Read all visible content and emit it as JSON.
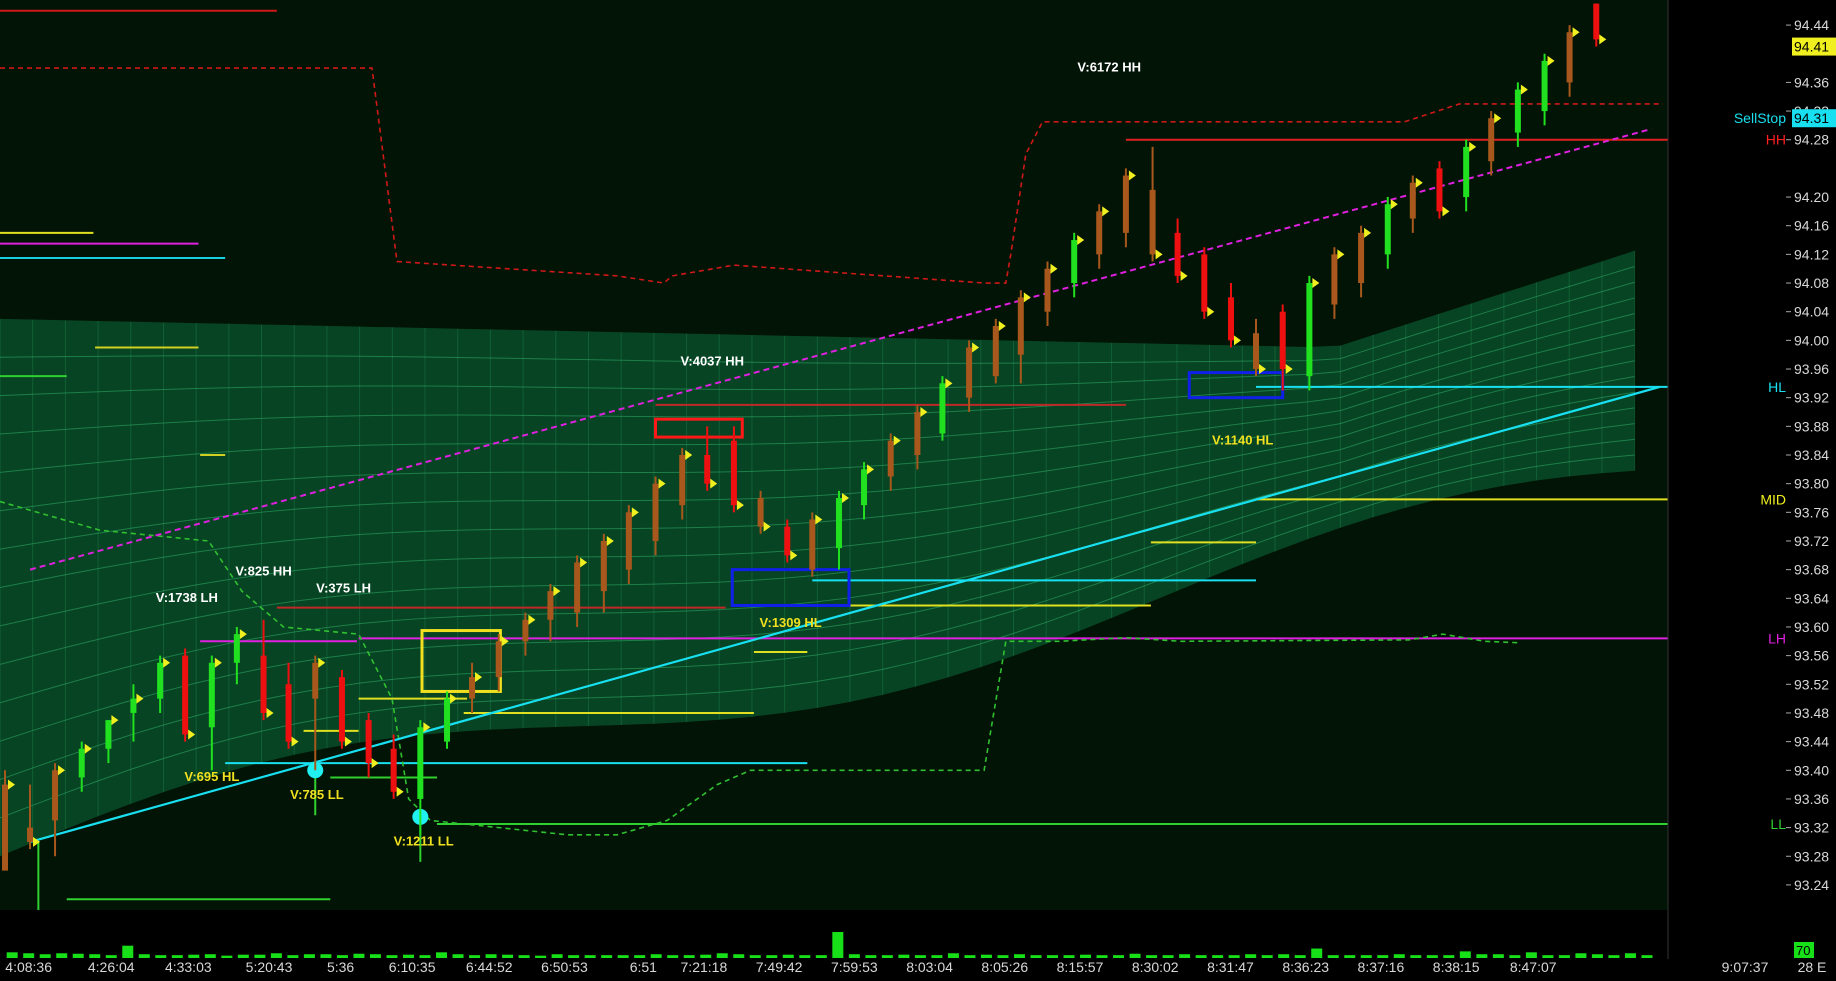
{
  "chart_data": {
    "type": "candlestick",
    "instrument_note": "",
    "y_axis": {
      "ticks": [
        "94.44",
        "94.36",
        "94.32",
        "94.28",
        "94.20",
        "94.16",
        "94.12",
        "94.08",
        "94.04",
        "94.00",
        "93.96",
        "93.92",
        "93.88",
        "93.84",
        "93.80",
        "93.76",
        "93.72",
        "93.68",
        "93.64",
        "93.60",
        "93.56",
        "93.52",
        "93.48",
        "93.44",
        "93.40",
        "93.36",
        "93.32",
        "93.28",
        "93.24"
      ],
      "ylim": [
        93.205,
        94.475
      ],
      "last_price": "94.41",
      "sell_stop_label": "SellStop",
      "sell_stop_value": "94.31"
    },
    "x_axis": {
      "ticks": [
        "4:08:36",
        "4:26:04",
        "4:33:03",
        "5:20:43",
        "5:36",
        "6:10:35",
        "6:44:52",
        "6:50:53",
        "6:51",
        "7:21:18",
        "7:49:42",
        "7:59:53",
        "8:03:04",
        "8:05:26",
        "8:15:57",
        "8:30:02",
        "8:31:47",
        "8:36:23",
        "8:37:16",
        "8:38:15",
        "8:47:07",
        "9:07:37"
      ],
      "xlim": [
        0,
        100
      ],
      "tail_label": "28 E",
      "volume_scale_label": "70"
    },
    "levels": [
      {
        "name": "HH",
        "price": 94.28,
        "color": "#ff2020"
      },
      {
        "name": "HL",
        "price": 93.935,
        "color": "#18e0f0"
      },
      {
        "name": "MID",
        "price": 93.778,
        "color": "#f0f020"
      },
      {
        "name": "LH",
        "price": 93.584,
        "color": "#e020e0"
      },
      {
        "name": "LL",
        "price": 93.325,
        "color": "#30d030"
      }
    ],
    "annotations": [
      {
        "text": "V:6172 HH",
        "x": 66.5,
        "y": 94.375,
        "color": "#ffffff"
      },
      {
        "text": "V:4037 HH",
        "x": 42.7,
        "y": 93.965,
        "color": "#ffffff"
      },
      {
        "text": "V:1140 HL",
        "x": 74.5,
        "y": 93.855,
        "color": "#f0e020"
      },
      {
        "text": "V:1309 HL",
        "x": 47.4,
        "y": 93.6,
        "color": "#f0e020"
      },
      {
        "text": "V:825 HH",
        "x": 15.8,
        "y": 93.672,
        "color": "#ffffff"
      },
      {
        "text": "V:375 LH",
        "x": 20.6,
        "y": 93.648,
        "color": "#ffffff"
      },
      {
        "text": "V:1738 LH",
        "x": 11.2,
        "y": 93.635,
        "color": "#ffffff"
      },
      {
        "text": "V:695 HL",
        "x": 12.7,
        "y": 93.385,
        "color": "#f0e020"
      },
      {
        "text": "V:785 LL",
        "x": 19.0,
        "y": 93.36,
        "color": "#f0e020"
      },
      {
        "text": "V:1211 LL",
        "x": 25.4,
        "y": 93.295,
        "color": "#f0e020"
      }
    ],
    "candles": [
      {
        "x": 0.3,
        "o": 93.26,
        "h": 93.4,
        "l": 93.27,
        "c": 93.38,
        "col": "brown"
      },
      {
        "x": 1.8,
        "o": 93.32,
        "h": 93.38,
        "l": 93.29,
        "c": 93.3,
        "col": "brown"
      },
      {
        "x": 3.3,
        "o": 93.33,
        "h": 93.41,
        "l": 93.28,
        "c": 93.4,
        "col": "brown"
      },
      {
        "x": 4.9,
        "o": 93.39,
        "h": 93.44,
        "l": 93.37,
        "c": 93.43,
        "col": "green"
      },
      {
        "x": 6.5,
        "o": 93.43,
        "h": 93.47,
        "l": 93.41,
        "c": 93.47,
        "col": "green"
      },
      {
        "x": 8.0,
        "o": 93.48,
        "h": 93.52,
        "l": 93.44,
        "c": 93.5,
        "col": "green"
      },
      {
        "x": 9.6,
        "o": 93.5,
        "h": 93.56,
        "l": 93.48,
        "c": 93.55,
        "col": "green"
      },
      {
        "x": 11.1,
        "o": 93.56,
        "h": 93.57,
        "l": 93.44,
        "c": 93.45,
        "col": "red"
      },
      {
        "x": 12.7,
        "o": 93.46,
        "h": 93.56,
        "l": 93.4,
        "c": 93.55,
        "col": "green"
      },
      {
        "x": 14.2,
        "o": 93.55,
        "h": 93.6,
        "l": 93.52,
        "c": 93.59,
        "col": "green"
      },
      {
        "x": 15.8,
        "o": 93.56,
        "h": 93.61,
        "l": 93.47,
        "c": 93.48,
        "col": "red"
      },
      {
        "x": 17.3,
        "o": 93.52,
        "h": 93.55,
        "l": 93.43,
        "c": 93.44,
        "col": "red"
      },
      {
        "x": 18.9,
        "o": 93.5,
        "h": 93.56,
        "l": 93.4,
        "c": 93.55,
        "col": "brown"
      },
      {
        "x": 20.5,
        "o": 93.53,
        "h": 93.54,
        "l": 93.43,
        "c": 93.44,
        "col": "red"
      },
      {
        "x": 22.1,
        "o": 93.47,
        "h": 93.48,
        "l": 93.39,
        "c": 93.41,
        "col": "red"
      },
      {
        "x": 23.6,
        "o": 93.43,
        "h": 93.45,
        "l": 93.36,
        "c": 93.37,
        "col": "red"
      },
      {
        "x": 25.2,
        "o": 93.36,
        "h": 93.47,
        "l": 93.31,
        "c": 93.46,
        "col": "green"
      },
      {
        "x": 26.8,
        "o": 93.44,
        "h": 93.51,
        "l": 93.43,
        "c": 93.5,
        "col": "green"
      },
      {
        "x": 28.3,
        "o": 93.5,
        "h": 93.55,
        "l": 93.48,
        "c": 93.53,
        "col": "brown"
      },
      {
        "x": 29.9,
        "o": 93.53,
        "h": 93.59,
        "l": 93.51,
        "c": 93.58,
        "col": "brown"
      },
      {
        "x": 31.5,
        "o": 93.58,
        "h": 93.62,
        "l": 93.56,
        "c": 93.61,
        "col": "brown"
      },
      {
        "x": 33.0,
        "o": 93.61,
        "h": 93.66,
        "l": 93.58,
        "c": 93.65,
        "col": "brown"
      },
      {
        "x": 34.6,
        "o": 93.62,
        "h": 93.7,
        "l": 93.6,
        "c": 93.69,
        "col": "brown"
      },
      {
        "x": 36.2,
        "o": 93.65,
        "h": 93.73,
        "l": 93.62,
        "c": 93.72,
        "col": "brown"
      },
      {
        "x": 37.7,
        "o": 93.68,
        "h": 93.77,
        "l": 93.66,
        "c": 93.76,
        "col": "brown"
      },
      {
        "x": 39.3,
        "o": 93.72,
        "h": 93.81,
        "l": 93.7,
        "c": 93.8,
        "col": "brown"
      },
      {
        "x": 40.9,
        "o": 93.77,
        "h": 93.85,
        "l": 93.75,
        "c": 93.84,
        "col": "brown"
      },
      {
        "x": 42.4,
        "o": 93.84,
        "h": 93.88,
        "l": 93.79,
        "c": 93.8,
        "col": "red"
      },
      {
        "x": 44.0,
        "o": 93.86,
        "h": 93.88,
        "l": 93.76,
        "c": 93.77,
        "col": "red"
      },
      {
        "x": 45.6,
        "o": 93.78,
        "h": 93.79,
        "l": 93.73,
        "c": 93.74,
        "col": "brown"
      },
      {
        "x": 47.2,
        "o": 93.74,
        "h": 93.75,
        "l": 93.69,
        "c": 93.7,
        "col": "red"
      },
      {
        "x": 48.7,
        "o": 93.68,
        "h": 93.76,
        "l": 93.67,
        "c": 93.75,
        "col": "brown"
      },
      {
        "x": 50.3,
        "o": 93.71,
        "h": 93.79,
        "l": 93.68,
        "c": 93.78,
        "col": "green"
      },
      {
        "x": 51.8,
        "o": 93.77,
        "h": 93.83,
        "l": 93.75,
        "c": 93.82,
        "col": "green"
      },
      {
        "x": 53.4,
        "o": 93.81,
        "h": 93.87,
        "l": 93.79,
        "c": 93.86,
        "col": "brown"
      },
      {
        "x": 55.0,
        "o": 93.84,
        "h": 93.91,
        "l": 93.82,
        "c": 93.9,
        "col": "brown"
      },
      {
        "x": 56.5,
        "o": 93.87,
        "h": 93.95,
        "l": 93.86,
        "c": 93.94,
        "col": "green"
      },
      {
        "x": 58.1,
        "o": 93.92,
        "h": 94.0,
        "l": 93.9,
        "c": 93.99,
        "col": "brown"
      },
      {
        "x": 59.7,
        "o": 93.95,
        "h": 94.03,
        "l": 93.94,
        "c": 94.02,
        "col": "brown"
      },
      {
        "x": 61.2,
        "o": 93.98,
        "h": 94.07,
        "l": 93.94,
        "c": 94.06,
        "col": "brown"
      },
      {
        "x": 62.8,
        "o": 94.04,
        "h": 94.11,
        "l": 94.02,
        "c": 94.1,
        "col": "brown"
      },
      {
        "x": 64.4,
        "o": 94.08,
        "h": 94.15,
        "l": 94.06,
        "c": 94.14,
        "col": "green"
      },
      {
        "x": 65.9,
        "o": 94.12,
        "h": 94.19,
        "l": 94.1,
        "c": 94.18,
        "col": "brown"
      },
      {
        "x": 67.5,
        "o": 94.15,
        "h": 94.24,
        "l": 94.13,
        "c": 94.23,
        "col": "brown"
      },
      {
        "x": 69.1,
        "o": 94.21,
        "h": 94.27,
        "l": 94.11,
        "c": 94.12,
        "col": "brown"
      },
      {
        "x": 70.6,
        "o": 94.15,
        "h": 94.17,
        "l": 94.08,
        "c": 94.09,
        "col": "red"
      },
      {
        "x": 72.2,
        "o": 94.12,
        "h": 94.13,
        "l": 94.03,
        "c": 94.04,
        "col": "red"
      },
      {
        "x": 73.8,
        "o": 94.06,
        "h": 94.08,
        "l": 93.99,
        "c": 94.0,
        "col": "red"
      },
      {
        "x": 75.3,
        "o": 94.01,
        "h": 94.03,
        "l": 93.95,
        "c": 93.96,
        "col": "brown"
      },
      {
        "x": 76.9,
        "o": 94.04,
        "h": 94.05,
        "l": 93.93,
        "c": 93.96,
        "col": "red"
      },
      {
        "x": 78.5,
        "o": 93.95,
        "h": 94.09,
        "l": 93.93,
        "c": 94.08,
        "col": "green"
      },
      {
        "x": 80.0,
        "o": 94.05,
        "h": 94.13,
        "l": 94.03,
        "c": 94.12,
        "col": "brown"
      },
      {
        "x": 81.6,
        "o": 94.08,
        "h": 94.16,
        "l": 94.06,
        "c": 94.15,
        "col": "brown"
      },
      {
        "x": 83.2,
        "o": 94.12,
        "h": 94.2,
        "l": 94.1,
        "c": 94.19,
        "col": "green"
      },
      {
        "x": 84.7,
        "o": 94.17,
        "h": 94.23,
        "l": 94.15,
        "c": 94.22,
        "col": "brown"
      },
      {
        "x": 86.3,
        "o": 94.24,
        "h": 94.25,
        "l": 94.17,
        "c": 94.18,
        "col": "red"
      },
      {
        "x": 87.9,
        "o": 94.2,
        "h": 94.28,
        "l": 94.18,
        "c": 94.27,
        "col": "green"
      },
      {
        "x": 89.4,
        "o": 94.25,
        "h": 94.32,
        "l": 94.23,
        "c": 94.31,
        "col": "brown"
      },
      {
        "x": 91.0,
        "o": 94.29,
        "h": 94.36,
        "l": 94.27,
        "c": 94.35,
        "col": "green"
      },
      {
        "x": 92.6,
        "o": 94.32,
        "h": 94.4,
        "l": 94.3,
        "c": 94.39,
        "col": "green"
      },
      {
        "x": 94.1,
        "o": 94.36,
        "h": 94.44,
        "l": 94.34,
        "c": 94.43,
        "col": "brown"
      },
      {
        "x": 95.7,
        "o": 94.47,
        "h": 94.47,
        "l": 94.41,
        "c": 94.42,
        "col": "red"
      }
    ],
    "volume": [
      12,
      10,
      8,
      10,
      9,
      8,
      6,
      26,
      8,
      6,
      6,
      7,
      8,
      5,
      7,
      7,
      10,
      6,
      8,
      8,
      6,
      9,
      8,
      6,
      7,
      6,
      12,
      8,
      6,
      8,
      7,
      6,
      5,
      8,
      6,
      6,
      6,
      6,
      6,
      8,
      6,
      6,
      7,
      10,
      8,
      6,
      6,
      7,
      6,
      6,
      55,
      8,
      6,
      6,
      7,
      6,
      6,
      10,
      6,
      7,
      6,
      8,
      6,
      6,
      6,
      7,
      6,
      6,
      9,
      6,
      6,
      8,
      6,
      6,
      6,
      8,
      6,
      8,
      6,
      20,
      6,
      6,
      6,
      6,
      8,
      6,
      6,
      6,
      14,
      8,
      8,
      6,
      12,
      6,
      6,
      10,
      8,
      6,
      10,
      6
    ]
  }
}
